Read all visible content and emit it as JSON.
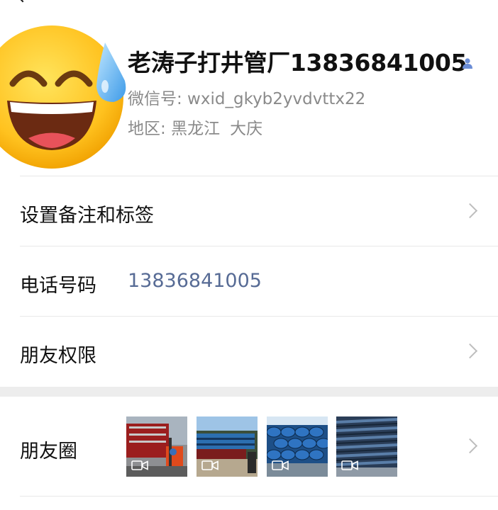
{
  "profile": {
    "name": "老涛子打井管厂13836841005",
    "wechat_id": "微信号: wxid_gkyb2yvdvttx22",
    "region_label": "地区:",
    "region_province": "黑龙江",
    "region_city": "大庆"
  },
  "rows": {
    "remarks_label": "设置备注和标签",
    "phone_label": "电话号码",
    "phone_value": "13836841005",
    "permissions_label": "朋友权限",
    "moments_label": "朋友圈"
  },
  "moments": {
    "thumbnails": [
      {
        "icon": "video-icon",
        "scene": "truck-loading-forklift"
      },
      {
        "icon": "video-icon",
        "scene": "truck-with-pipes"
      },
      {
        "icon": "video-icon",
        "scene": "blue-pipe-stack"
      },
      {
        "icon": "video-icon",
        "scene": "blue-corrugated-pipes"
      }
    ]
  },
  "colors": {
    "link_blue": "#576b95",
    "secondary_text": "#8a8a8a",
    "divider": "#e8e8e8",
    "section_gap": "#ededed"
  }
}
